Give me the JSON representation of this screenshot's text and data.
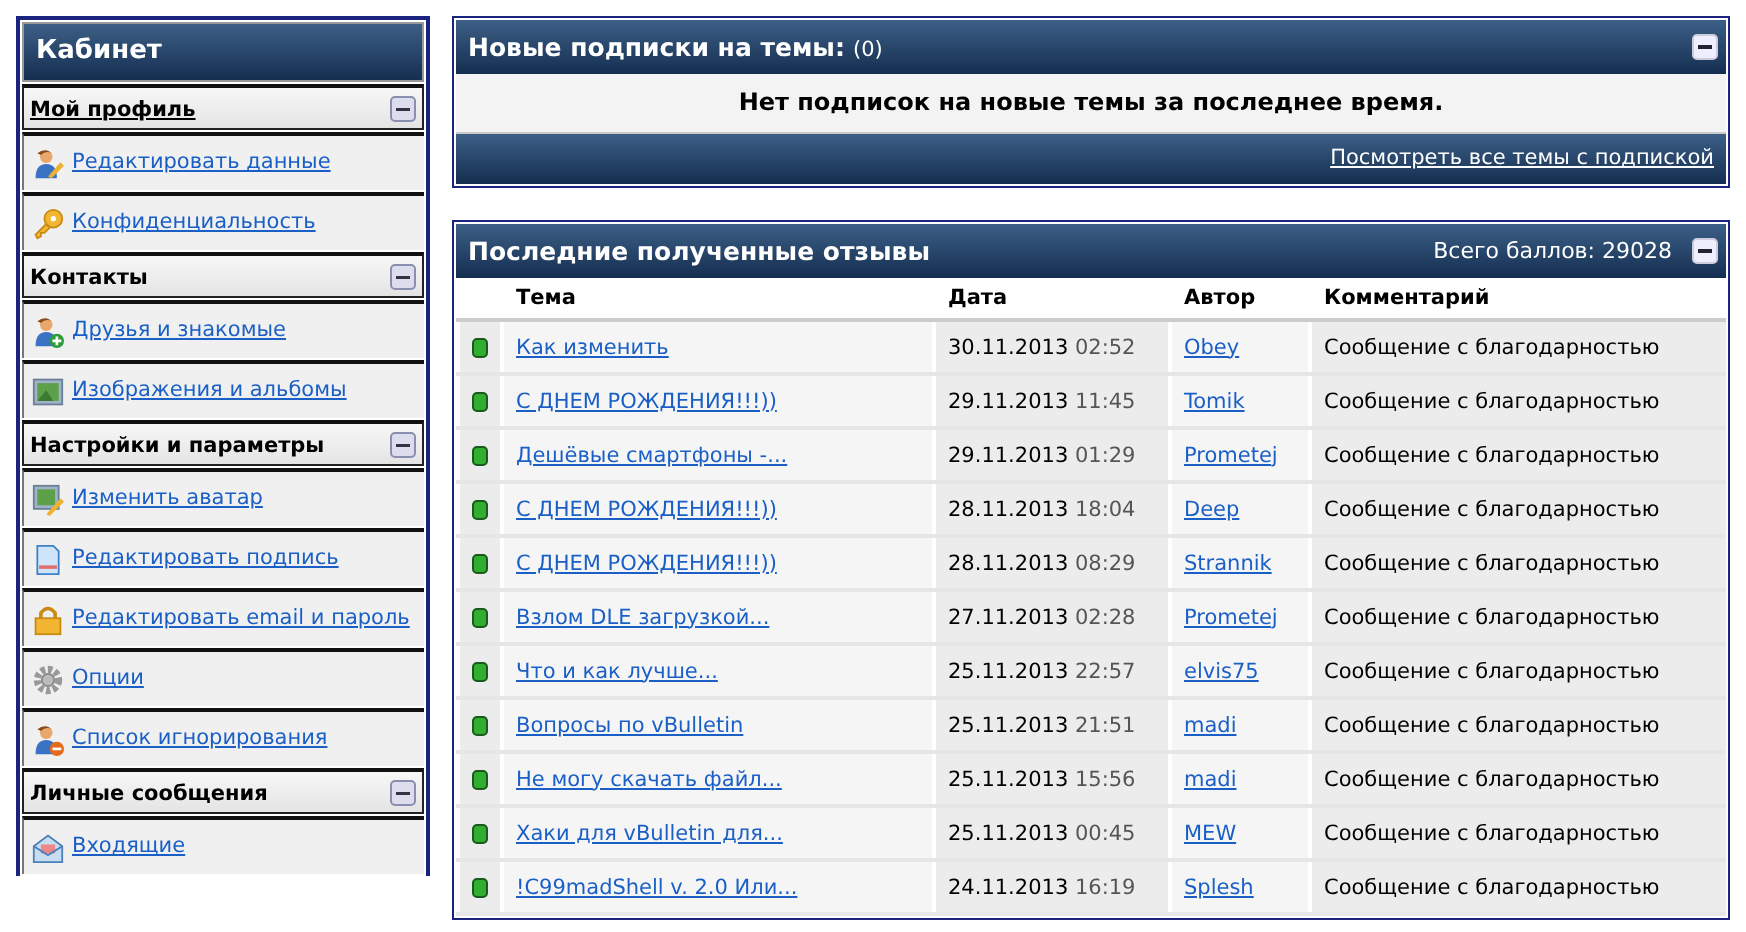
{
  "sidebar": {
    "title": "Кабинет",
    "sections": [
      {
        "title": "Мой профиль",
        "link": true,
        "items": [
          "Редактировать данные",
          "Конфиденциальность"
        ]
      },
      {
        "title": "Контакты",
        "link": false,
        "items": [
          "Друзья и знакомые",
          "Изображения и альбомы"
        ]
      },
      {
        "title": "Настройки и параметры",
        "link": false,
        "items": [
          "Изменить аватар",
          "Редактировать подпись",
          "Редактировать email и пароль",
          "Опции",
          "Список игнорирования"
        ]
      },
      {
        "title": "Личные сообщения",
        "link": false,
        "items": [
          "Входящие"
        ]
      }
    ]
  },
  "subscriptions": {
    "title": "Новые подписки на темы:",
    "count": "(0)",
    "message": "Нет подписок на новые темы за последнее время.",
    "footer_link": "Посмотреть все темы с подпиской"
  },
  "feedback": {
    "title": "Последние полученные отзывы",
    "total": "Всего баллов: 29028",
    "columns": [
      "Тема",
      "Дата",
      "Автор",
      "Комментарий"
    ],
    "rows": [
      {
        "topic": "Как изменить",
        "date": "30.11.2013",
        "time": "02:52",
        "author": "Obey",
        "comment": "Сообщение с благодарностью"
      },
      {
        "topic": "С ДНЕМ РОЖДЕНИЯ!!!))",
        "date": "29.11.2013",
        "time": "11:45",
        "author": "Tomik",
        "comment": "Сообщение с благодарностью"
      },
      {
        "topic": "Дешёвые смартфоны -...",
        "date": "29.11.2013",
        "time": "01:29",
        "author": "Prometej",
        "comment": "Сообщение с благодарностью"
      },
      {
        "topic": "С ДНЕМ РОЖДЕНИЯ!!!))",
        "date": "28.11.2013",
        "time": "18:04",
        "author": "Deep",
        "comment": "Сообщение с благодарностью"
      },
      {
        "topic": "С ДНЕМ РОЖДЕНИЯ!!!))",
        "date": "28.11.2013",
        "time": "08:29",
        "author": "Strannik",
        "comment": "Сообщение с благодарностью"
      },
      {
        "topic": "Взлом DLE загрузкой...",
        "date": "27.11.2013",
        "time": "02:28",
        "author": "Prometej",
        "comment": "Сообщение с благодарностью"
      },
      {
        "topic": "Что и как лучше...",
        "date": "25.11.2013",
        "time": "22:57",
        "author": "elvis75",
        "comment": "Сообщение с благодарностью"
      },
      {
        "topic": "Вопросы по vBulletin",
        "date": "25.11.2013",
        "time": "21:51",
        "author": "madi",
        "comment": "Сообщение с благодарностью"
      },
      {
        "topic": "Не могу скачать файл...",
        "date": "25.11.2013",
        "time": "15:56",
        "author": "madi",
        "comment": "Сообщение с благодарностью"
      },
      {
        "topic": "Хаки для vBulletin для...",
        "date": "25.11.2013",
        "time": "00:45",
        "author": "MEW",
        "comment": "Сообщение с благодарностью"
      },
      {
        "topic": "!C99madShell v. 2.0 Или...",
        "date": "24.11.2013",
        "time": "16:19",
        "author": "Splesh",
        "comment": "Сообщение с благодарностью"
      }
    ]
  }
}
